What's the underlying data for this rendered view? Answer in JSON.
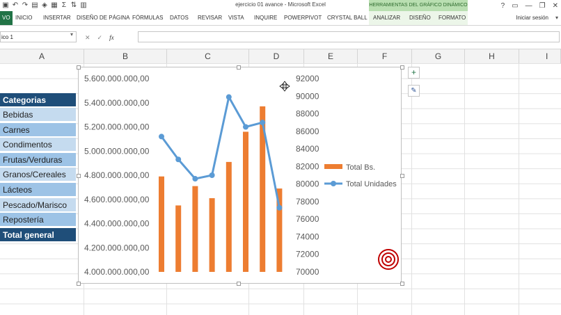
{
  "window": {
    "title": "ejercicio 01 avance - Microsoft Excel",
    "tools_title": "HERRAMIENTAS DEL GRÁFICO DINÁMICO",
    "controls": [
      "?",
      "—",
      "❐",
      "✕"
    ]
  },
  "ribbon": {
    "tabs": [
      "VO",
      "INICIO",
      "INSERTAR",
      "DISEÑO DE PÁGINA",
      "FÓRMULAS",
      "DATOS",
      "REVISAR",
      "VISTA",
      "INQUIRE",
      "POWERPIVOT",
      "CRYSTAL BALL"
    ],
    "tool_tabs": [
      "ANALIZAR",
      "DISEÑO",
      "FORMATO"
    ],
    "user": "Iniciar sesión"
  },
  "formula_bar": {
    "name_box": "ico 1",
    "cancel": "✕",
    "enter": "✓",
    "fx": "fx",
    "value": ""
  },
  "columns": [
    "A",
    "B",
    "C",
    "D",
    "E",
    "F",
    "G",
    "H",
    "I"
  ],
  "table": {
    "header": "Categorias",
    "rows": [
      "Bebidas",
      "Carnes",
      "Condimentos",
      "Frutas/Verduras",
      "Granos/Cereales",
      "Lácteos",
      "Pescado/Marisco",
      "Repostería"
    ],
    "total": "Total general"
  },
  "chart_data": {
    "type": "bar",
    "categories": [
      "Bebidas",
      "Carnes",
      "Condimentos",
      "Frutas/Verduras",
      "Granos/Cereales",
      "Lácteos",
      "Pescado/Marisco",
      "Repostería"
    ],
    "series": [
      {
        "name": "Total Bs.",
        "type": "bar",
        "axis": "left",
        "color": "#ed7d31",
        "values": [
          4790000000,
          4550000000,
          4710000000,
          4610000000,
          4910000000,
          5160000000,
          5370000000,
          4690000000
        ]
      },
      {
        "name": "Total Unidades",
        "type": "line",
        "axis": "right",
        "color": "#5b9bd5",
        "values": [
          85400,
          82800,
          80600,
          81000,
          89900,
          86500,
          87000,
          77300
        ]
      }
    ],
    "y_left": {
      "min": 4000000000,
      "max": 5600000000,
      "ticks": [
        "5.600.000.000,00",
        "5.400.000.000,00",
        "5.200.000.000,00",
        "5.000.000.000,00",
        "4.800.000.000,00",
        "4.600.000.000,00",
        "4.400.000.000,00",
        "4.200.000.000,00",
        "4.000.000.000,00"
      ]
    },
    "y_right": {
      "min": 70000,
      "max": 92000,
      "ticks": [
        "92000",
        "90000",
        "88000",
        "86000",
        "84000",
        "82000",
        "80000",
        "78000",
        "76000",
        "74000",
        "72000",
        "70000"
      ]
    },
    "legend": "right",
    "grid": false
  },
  "chart_buttons": {
    "add": "+",
    "style": "✎"
  }
}
